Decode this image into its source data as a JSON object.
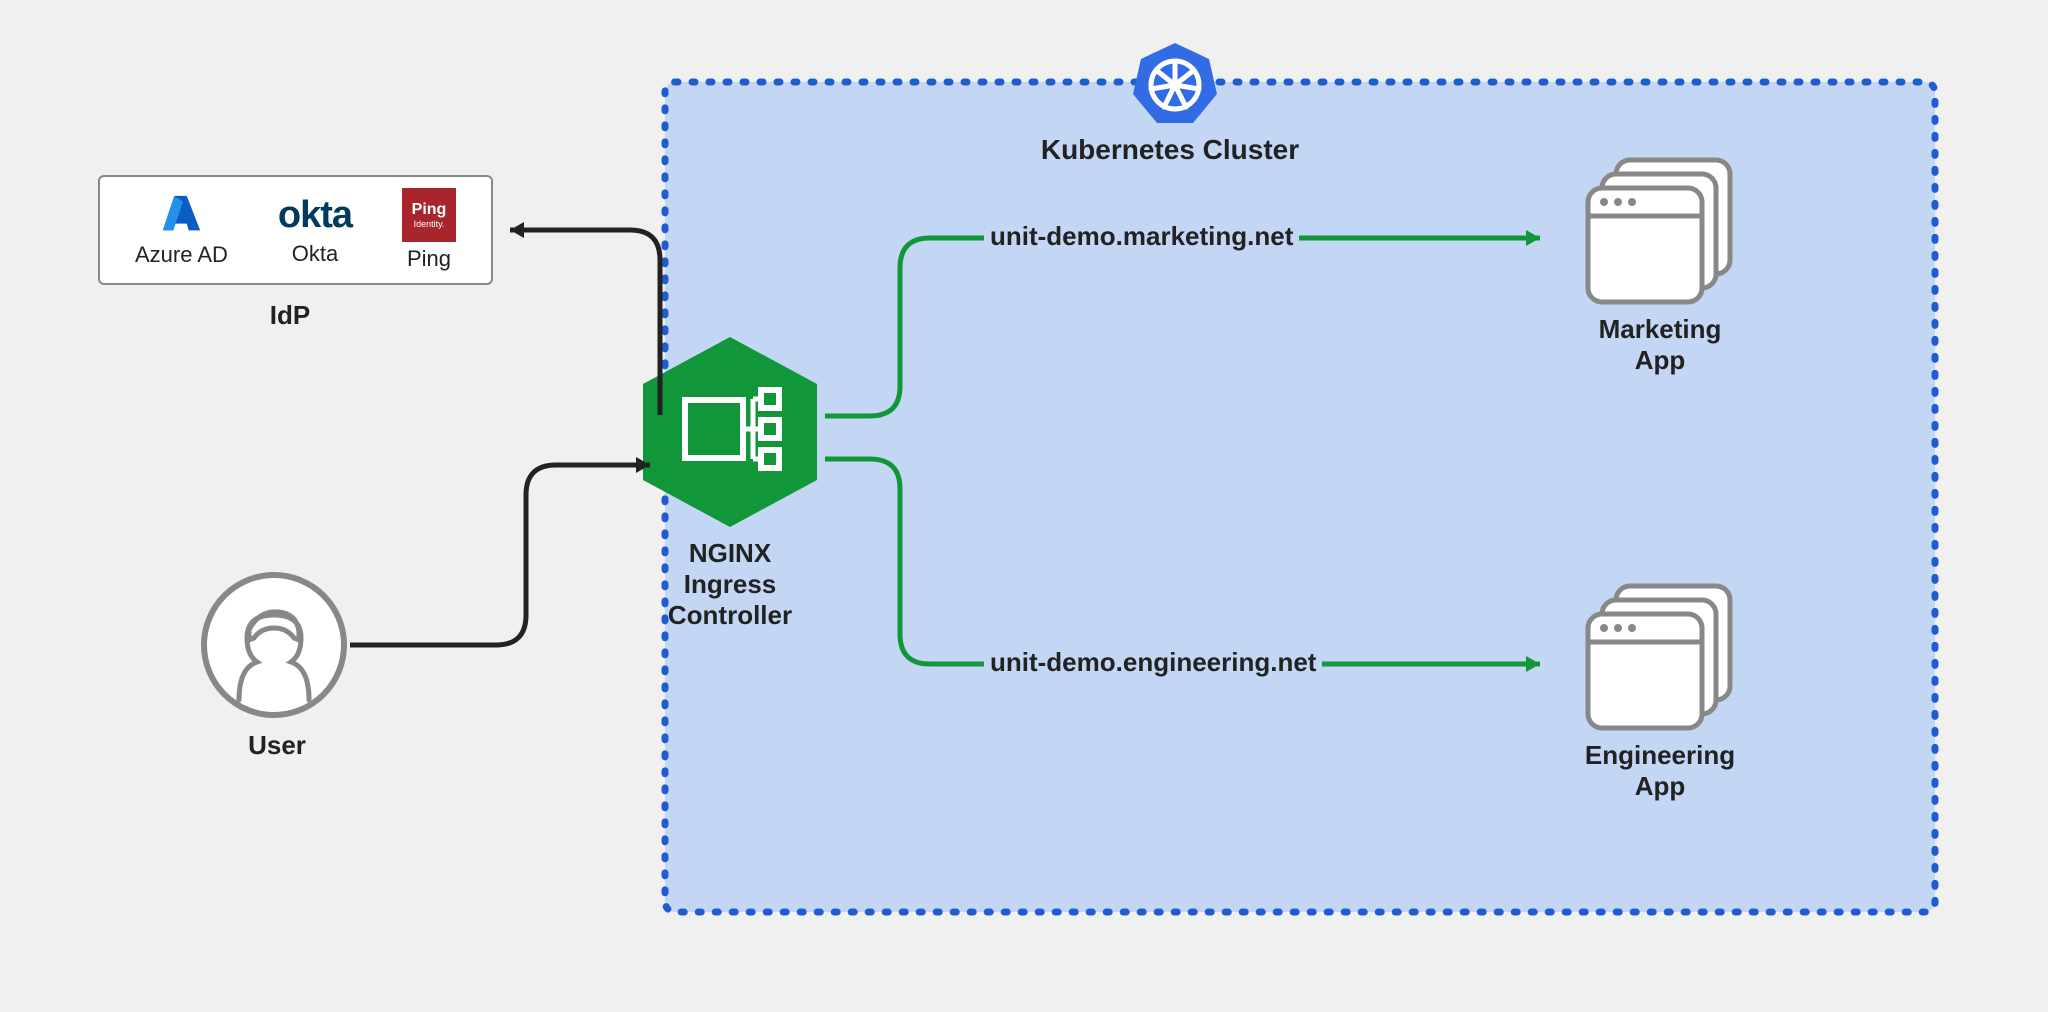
{
  "idp": {
    "label": "IdP",
    "providers": [
      {
        "name": "Azure AD"
      },
      {
        "name": "Okta"
      },
      {
        "name": "Ping"
      }
    ]
  },
  "user": {
    "label": "User"
  },
  "nginx": {
    "line1": "NGINX",
    "line2": "Ingress",
    "line3": "Controller"
  },
  "cluster": {
    "label": "Kubernetes Cluster"
  },
  "routes": [
    {
      "url": "unit-demo.marketing.net",
      "app_line1": "Marketing",
      "app_line2": "App"
    },
    {
      "url": "unit-demo.engineering.net",
      "app_line1": "Engineering",
      "app_line2": "App"
    }
  ]
}
